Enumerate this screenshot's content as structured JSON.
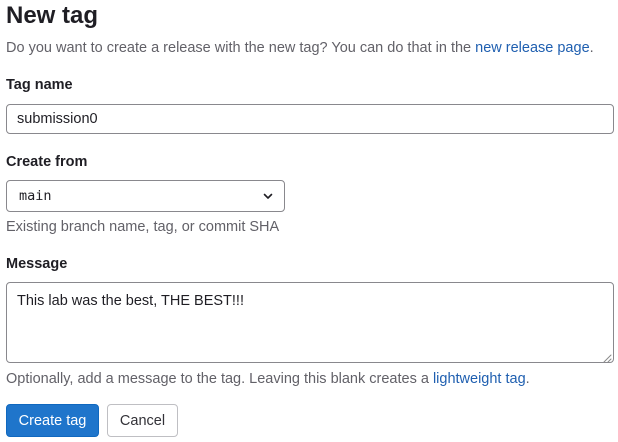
{
  "page": {
    "title": "New tag",
    "intro_text": "Do you want to create a release with the new tag? You can do that in the ",
    "intro_link": "new release page",
    "intro_end": "."
  },
  "form": {
    "tag_name": {
      "label": "Tag name",
      "value": "submission0"
    },
    "create_from": {
      "label": "Create from",
      "value": "main",
      "help": "Existing branch name, tag, or commit SHA",
      "icon": "chevron-down-icon"
    },
    "message": {
      "label": "Message",
      "value": "This lab was the best, THE BEST!!!",
      "help_text": "Optionally, add a message to the tag. Leaving this blank creates a ",
      "help_link": "lightweight tag",
      "help_end": "."
    }
  },
  "actions": {
    "create_label": "Create tag",
    "cancel_label": "Cancel"
  },
  "colors": {
    "primary": "#1f75cb",
    "link": "#1f5fb0",
    "text": "#333238",
    "muted": "#626168",
    "border": "#89888d"
  }
}
